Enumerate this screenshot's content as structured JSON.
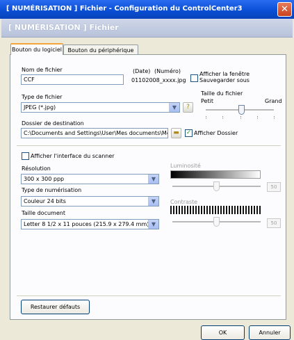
{
  "window": {
    "title": "[ NUMÉRISATION ]  Fichier - Configuration du ControlCenter3"
  },
  "header": {
    "title": "[ NUMÉRISATION ]  Fichier"
  },
  "tabs": [
    {
      "label": "Bouton du logiciel",
      "active": true
    },
    {
      "label": "Bouton du périphérique",
      "active": false
    }
  ],
  "file_name": {
    "label": "Nom de fichier",
    "value": "CCF",
    "date_label": "(Date)",
    "number_label": "(Numéro)",
    "example": "01102008_xxxx.jpg"
  },
  "save_as": {
    "label_line1": "Afficher la fenêtre",
    "label_line2": "Sauvegarder sous",
    "checked": false
  },
  "file_size": {
    "label": "Taille du fichier",
    "small": "Petit",
    "large": "Grand"
  },
  "file_type": {
    "label": "Type de fichier",
    "value": "JPEG (*.jpg)"
  },
  "destination": {
    "label": "Dossier de destination",
    "value": "C:\\Documents and Settings\\User\\Mes documents\\Me",
    "show_folder_label": "Afficher Dossier",
    "show_folder_checked": true
  },
  "scanner_interface": {
    "label": "Afficher l'interface du scanner",
    "checked": false
  },
  "resolution": {
    "label": "Résolution",
    "value": "300 x 300 ppp"
  },
  "scan_type": {
    "label": "Type de numérisation",
    "value": "Couleur 24 bits"
  },
  "doc_size": {
    "label": "Taille document",
    "value": "Letter 8 1/2 x 11 pouces (215.9 x 279.4 mm)"
  },
  "brightness": {
    "label": "Luminosité",
    "value": "50"
  },
  "contrast": {
    "label": "Contraste",
    "value": "50"
  },
  "buttons": {
    "restore": "Restaurer défauts",
    "ok": "OK",
    "cancel": "Annuler"
  }
}
